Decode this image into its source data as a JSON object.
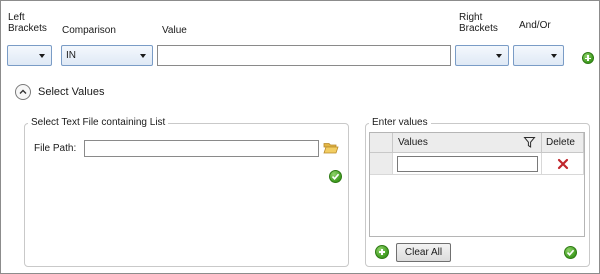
{
  "header": {
    "left_brackets_line1": "Left",
    "left_brackets_line2": "Brackets",
    "comparison": "Comparison",
    "value": "Value",
    "right_brackets_line1": "Right",
    "right_brackets_line2": "Brackets",
    "and_or": "And/Or"
  },
  "row": {
    "left_bracket_value": "",
    "comparison_value": "IN",
    "value_text": "",
    "right_bracket_value": "",
    "and_or_value": ""
  },
  "select_values": {
    "toggle_label": "Select Values"
  },
  "file_group": {
    "title": "Select Text File containing List",
    "file_path_label": "File Path:",
    "file_path_value": ""
  },
  "enter_values": {
    "title": "Enter values",
    "col_values": "Values",
    "col_delete": "Delete",
    "new_value": "",
    "clear_all_label": "Clear All"
  },
  "icons": {
    "add": "plus-circle-icon",
    "folder": "folder-open-icon",
    "ok": "checkmark-icon",
    "filter": "filter-icon",
    "delete": "red-x-icon",
    "collapse": "chevron-up-icon"
  },
  "colors": {
    "combo_border": "#7a9cc6",
    "green": "#3f9b1f",
    "delete_red": "#c0262c"
  }
}
